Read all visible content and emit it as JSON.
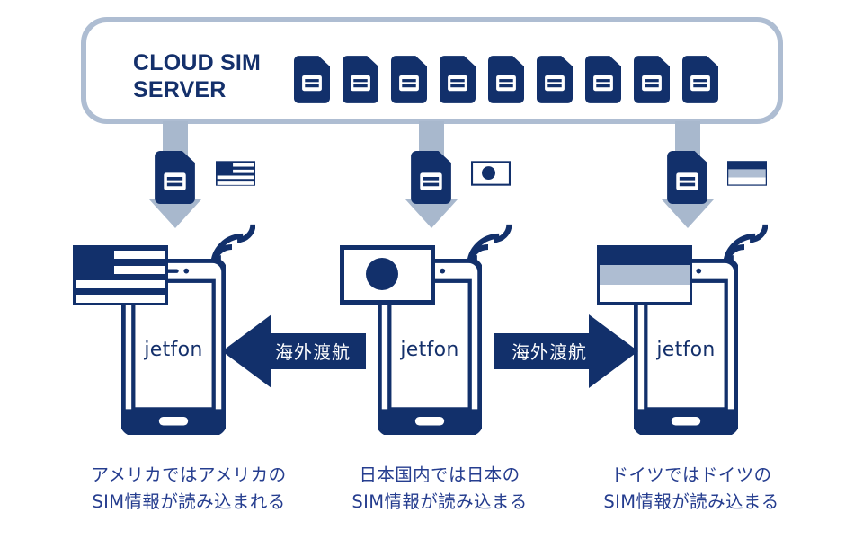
{
  "diagram": {
    "title_visible": false,
    "colors": {
      "navy": "#12306b",
      "navy_deep": "#0e2b63",
      "gray_blue": "#aebdd2",
      "gray_arrow": "#a8b8cd",
      "caption_blue": "#253d8f",
      "white": "#ffffff",
      "german_band_mid": "#aebdd2"
    },
    "server": {
      "label_line1": "CLOUD SIM",
      "label_line2": "SERVER",
      "sim_icon_name": "sim-card-icon",
      "sim_count": 9
    },
    "columns": [
      {
        "id": "usa",
        "country": "アメリカ",
        "flag_icon": "flag-usa-icon",
        "sim_icon": "sim-card-icon",
        "download_arrow_icon": "arrow-down-icon",
        "wifi_icon": "wifi-signal-icon",
        "phone_label": "jetfon",
        "caption_line1": "アメリカではアメリカの",
        "caption_line2": "SIM情報が読み込まれる"
      },
      {
        "id": "japan",
        "country": "日本",
        "flag_icon": "flag-japan-icon",
        "sim_icon": "sim-card-icon",
        "download_arrow_icon": "arrow-down-icon",
        "wifi_icon": "wifi-signal-icon",
        "phone_label": "jetfon",
        "caption_line1": "日本国内では日本の",
        "caption_line2": "SIM情報が読み込まる"
      },
      {
        "id": "germany",
        "country": "ドイツ",
        "flag_icon": "flag-germany-icon",
        "sim_icon": "sim-card-icon",
        "download_arrow_icon": "arrow-down-icon",
        "wifi_icon": "wifi-signal-icon",
        "phone_label": "jetfon",
        "caption_line1": "ドイツではドイツの",
        "caption_line2": "SIM情報が読み込まる"
      }
    ],
    "travel_arrows": [
      {
        "id": "left",
        "label": "海外渡航",
        "direction": "left",
        "icon": "arrow-left-icon"
      },
      {
        "id": "right",
        "label": "海外渡航",
        "direction": "right",
        "icon": "arrow-right-icon"
      }
    ]
  }
}
